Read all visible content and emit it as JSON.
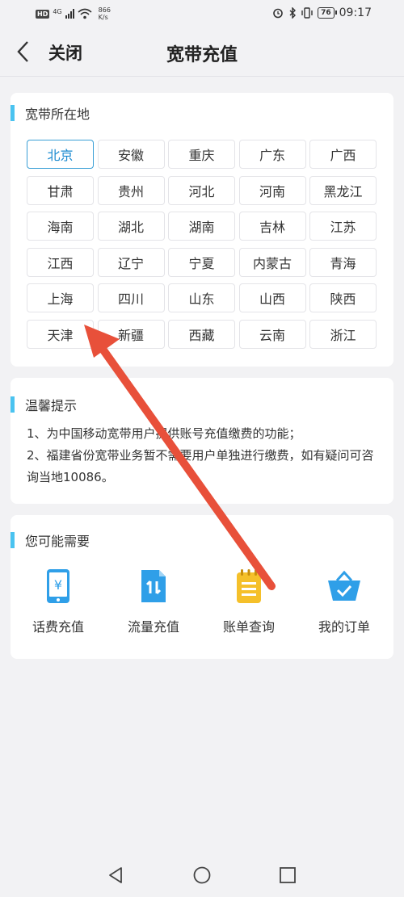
{
  "status_bar": {
    "hd": "HD",
    "network": "4G",
    "speed_value": "866",
    "speed_unit": "K/s",
    "battery": "76",
    "time": "09:17"
  },
  "nav": {
    "close_label": "关闭",
    "title": "宽带充值"
  },
  "region": {
    "title": "宽带所在地",
    "selected": "北京",
    "items": [
      "北京",
      "安徽",
      "重庆",
      "广东",
      "广西",
      "甘肃",
      "贵州",
      "河北",
      "河南",
      "黑龙江",
      "海南",
      "湖北",
      "湖南",
      "吉林",
      "江苏",
      "江西",
      "辽宁",
      "宁夏",
      "内蒙古",
      "青海",
      "上海",
      "四川",
      "山东",
      "山西",
      "陕西",
      "天津",
      "新疆",
      "西藏",
      "云南",
      "浙江"
    ]
  },
  "tips": {
    "title": "温馨提示",
    "line1": "1、为中国移动宽带用户提供账号充值缴费的功能；",
    "line2": "2、福建省份宽带业务暂不需要用户单独进行缴费，如有疑问可咨询当地10086。"
  },
  "services": {
    "title": "您可能需要",
    "items": [
      {
        "label": "话费充值",
        "icon": "phone-recharge-icon"
      },
      {
        "label": "流量充值",
        "icon": "data-recharge-icon"
      },
      {
        "label": "账单查询",
        "icon": "bill-query-icon"
      },
      {
        "label": "我的订单",
        "icon": "my-orders-basket-icon"
      }
    ]
  },
  "colors": {
    "accent": "#4ac3f0",
    "selected_border": "#3a9fd6",
    "annotation_arrow": "#e8503a"
  }
}
